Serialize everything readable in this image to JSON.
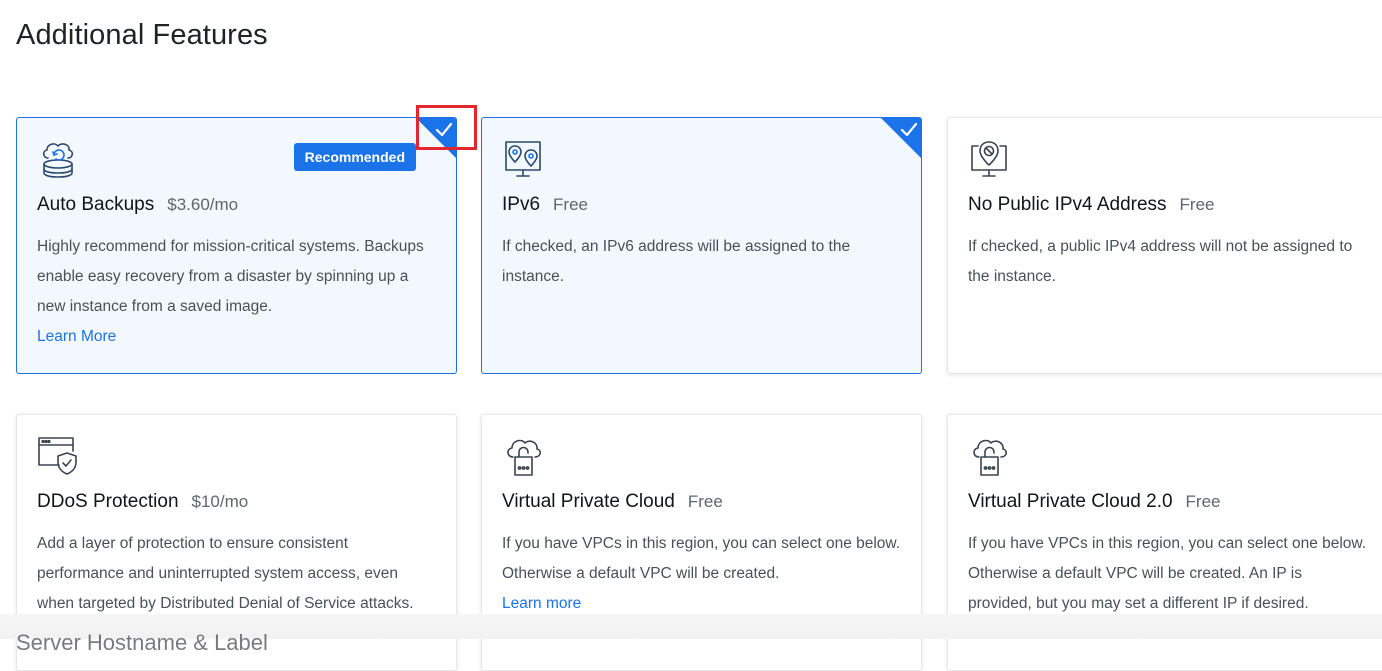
{
  "section": {
    "title": "Additional Features",
    "next_title": "Server Hostname & Label"
  },
  "colors": {
    "accent": "#1a73e8",
    "highlight": "#e3262f"
  },
  "cards": [
    {
      "name": "Auto Backups",
      "price": "$3.60/mo",
      "badge": "Recommended",
      "desc": "Highly recommend for mission-critical systems. Backups enable easy recovery from a disaster by spinning up a new instance from a saved image.",
      "link": "Learn More",
      "selected": true,
      "icon": "backup-icon"
    },
    {
      "name": "IPv6",
      "price": "Free",
      "desc": "If checked, an IPv6 address will be assigned to the instance.",
      "selected": true,
      "icon": "ipv6-location-icon"
    },
    {
      "name": "No Public IPv4 Address",
      "price": "Free",
      "desc": "If checked, a public IPv4 address will not be assigned to the instance.",
      "selected": false,
      "icon": "no-ipv4-icon"
    },
    {
      "name": "DDoS Protection",
      "price": "$10/mo",
      "desc": "Add a layer of protection to ensure consistent performance and uninterrupted system access, even when targeted by Distributed Denial of Service attacks.",
      "selected": false,
      "icon": "shield-window-icon"
    },
    {
      "name": "Virtual Private Cloud",
      "price": "Free",
      "desc": "If you have VPCs in this region, you can select one below. Otherwise a default VPC will be created.",
      "link": "Learn more",
      "selected": false,
      "icon": "cloud-lock-icon"
    },
    {
      "name": "Virtual Private Cloud 2.0",
      "price": "Free",
      "desc": "If you have VPCs in this region, you can select one below. Otherwise a default VPC will be created. An IP is provided, but you may set a different IP if desired.",
      "selected": false,
      "icon": "cloud-lock-icon"
    }
  ]
}
